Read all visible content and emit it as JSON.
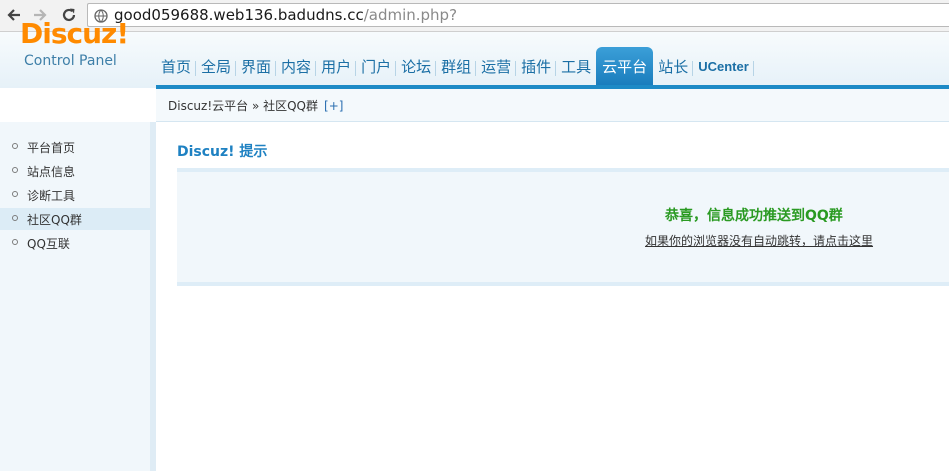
{
  "browser": {
    "url_host": "good059688.web136.badudns.cc",
    "url_path": "/admin.php?"
  },
  "header": {
    "logo": "Discuz!",
    "logo_sub": "Control Panel"
  },
  "topnav": {
    "items": [
      {
        "label": "首页"
      },
      {
        "label": "全局"
      },
      {
        "label": "界面"
      },
      {
        "label": "内容"
      },
      {
        "label": "用户"
      },
      {
        "label": "门户"
      },
      {
        "label": "论坛"
      },
      {
        "label": "群组"
      },
      {
        "label": "运营"
      },
      {
        "label": "插件"
      },
      {
        "label": "工具"
      },
      {
        "label": "云平台",
        "active": true
      },
      {
        "label": "站长"
      },
      {
        "label": "UCenter"
      }
    ]
  },
  "breadcrumb": {
    "path": "Discuz!云平台 » 社区QQ群",
    "plus": "[+]"
  },
  "sidebar": {
    "items": [
      {
        "label": "平台首页"
      },
      {
        "label": "站点信息"
      },
      {
        "label": "诊断工具"
      },
      {
        "label": "社区QQ群",
        "active": true
      },
      {
        "label": "QQ互联"
      }
    ]
  },
  "content": {
    "title": "Discuz! 提示",
    "message": "恭喜，信息成功推送到QQ群",
    "redirect_link": "如果你的浏览器没有自动跳转，请点击这里"
  },
  "colors": {
    "logo": "#ff8a00",
    "nav_text": "#1b6fa5",
    "nav_active": "#1a7dbd",
    "success": "#2a9a22"
  }
}
